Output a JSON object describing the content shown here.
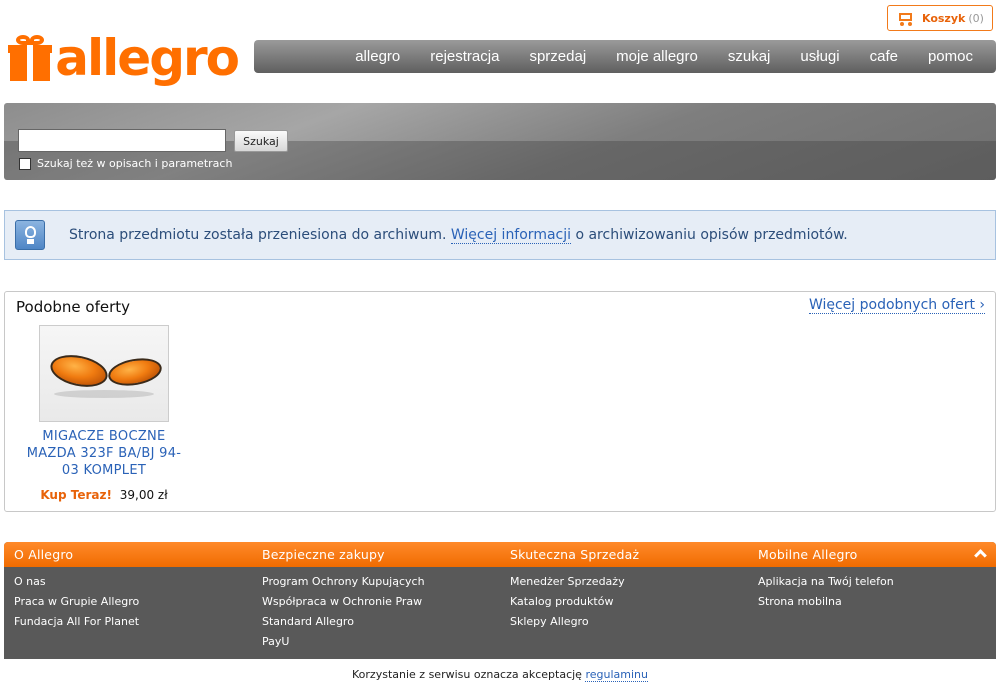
{
  "brand": {
    "name": "allegro",
    "accent": "#ff6f00"
  },
  "cart": {
    "label": "Koszyk",
    "count": "(0)",
    "icon": "cart-icon"
  },
  "nav": {
    "items": [
      {
        "label": "allegro"
      },
      {
        "label": "rejestracja"
      },
      {
        "label": "sprzedaj"
      },
      {
        "label": "moje allegro"
      },
      {
        "label": "szukaj"
      },
      {
        "label": "usługi"
      },
      {
        "label": "cafe"
      },
      {
        "label": "pomoc"
      }
    ]
  },
  "search": {
    "value": "",
    "button_label": "Szukaj",
    "checkbox_label": "Szukaj też w opisach i parametrach",
    "checkbox_checked": false
  },
  "info": {
    "icon": "lightbulb-icon",
    "text_before": "Strona przedmiotu została przeniesiona do archiwum. ",
    "link": "Więcej informacji",
    "text_after": " o archiwizowaniu opisów przedmiotów."
  },
  "offers": {
    "title": "Podobne oferty",
    "more_link": "Więcej podobnych ofert ›",
    "items": [
      {
        "title": "MIGACZE BOCZNE MAZDA 323F BA/BJ 94-03 KOMPLET",
        "buy_now": "Kup Teraz!",
        "price": "39,00 zł"
      }
    ]
  },
  "footer": {
    "columns": [
      {
        "heading": "O Allegro",
        "links": [
          "O nas",
          "Praca w Grupie Allegro",
          "Fundacja All For Planet"
        ]
      },
      {
        "heading": "Bezpieczne zakupy",
        "links": [
          "Program Ochrony Kupujących",
          "Współpraca w Ochronie Praw",
          "Standard Allegro",
          "PayU"
        ]
      },
      {
        "heading": "Skuteczna Sprzedaż",
        "links": [
          "Menedżer Sprzedaży",
          "Katalog produktów",
          "Sklepy Allegro"
        ]
      },
      {
        "heading": "Mobilne Allegro",
        "links": [
          "Aplikacja na Twój telefon",
          "Strona mobilna"
        ]
      }
    ],
    "collapse_icon": "chevron-up-icon"
  },
  "legal": {
    "text": "Korzystanie z serwisu oznacza akceptację ",
    "link": "regulaminu"
  }
}
